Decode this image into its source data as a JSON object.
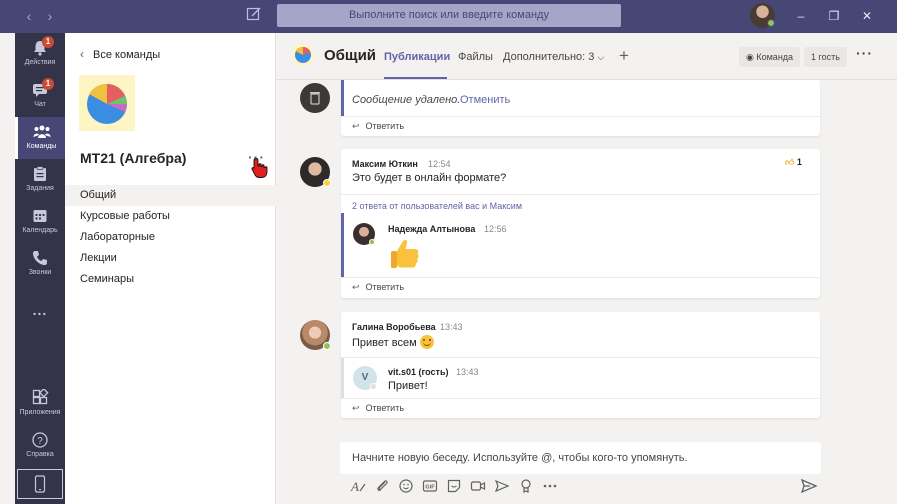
{
  "titlebar": {
    "search_placeholder": "Выполните поиск или введите команду",
    "back_icon": "chevron-left-icon",
    "forward_icon": "chevron-right-icon"
  },
  "rail": {
    "items": [
      {
        "label": "Действия",
        "icon": "bell-icon",
        "badge": "1"
      },
      {
        "label": "Чат",
        "icon": "chat-icon",
        "badge": "1"
      },
      {
        "label": "Команды",
        "icon": "teams-icon",
        "active": true
      },
      {
        "label": "Задания",
        "icon": "assignments-icon"
      },
      {
        "label": "Календарь",
        "icon": "calendar-icon"
      },
      {
        "label": "Звонки",
        "icon": "phone-icon"
      },
      {
        "label": "...",
        "icon": "more-icon"
      },
      {
        "label": "Приложения",
        "icon": "apps-icon"
      },
      {
        "label": "Справка",
        "icon": "help-icon"
      }
    ]
  },
  "leftpanel": {
    "back_label": "Все команды",
    "team_name": "МТ21 (Алгебра)",
    "more": "···",
    "channels": [
      "Общий",
      "Курсовые работы",
      "Лабораторные",
      "Лекции",
      "Семинары"
    ]
  },
  "header": {
    "channel_title": "Общий",
    "tabs": [
      "Публикации",
      "Файлы",
      "Дополнительно: 3"
    ],
    "add_tab": "+",
    "team_button": "Команда",
    "guest_button": "1 гость",
    "more": "···"
  },
  "messages": {
    "deleted": {
      "text": "Сообщение удалено.",
      "undo": "Отменить",
      "reply": "Ответить"
    },
    "post1": {
      "author": "Максим Юткин",
      "time": "12:54",
      "text": "Это будет в онлайн формате?",
      "likes": "1",
      "replies_link": "2 ответа от пользователей вас и Максим",
      "reply_author": "Надежда Алтынова",
      "reply_time": "12:56",
      "reply": "Ответить"
    },
    "post2": {
      "author": "Галина Воробьева",
      "time": "13:43",
      "text": "Привет всем",
      "reply_author": "vit.s01 (гость)",
      "reply_initial": "V",
      "reply_time": "13:43",
      "reply_text": "Привет!",
      "reply": "Ответить"
    }
  },
  "compose": {
    "placeholder": "Начните новую беседу. Используйте @, чтобы кого-то упомянуть."
  },
  "colors": {
    "titlebar": "#464775",
    "rail": "#33344a",
    "accent": "#6264a7"
  }
}
